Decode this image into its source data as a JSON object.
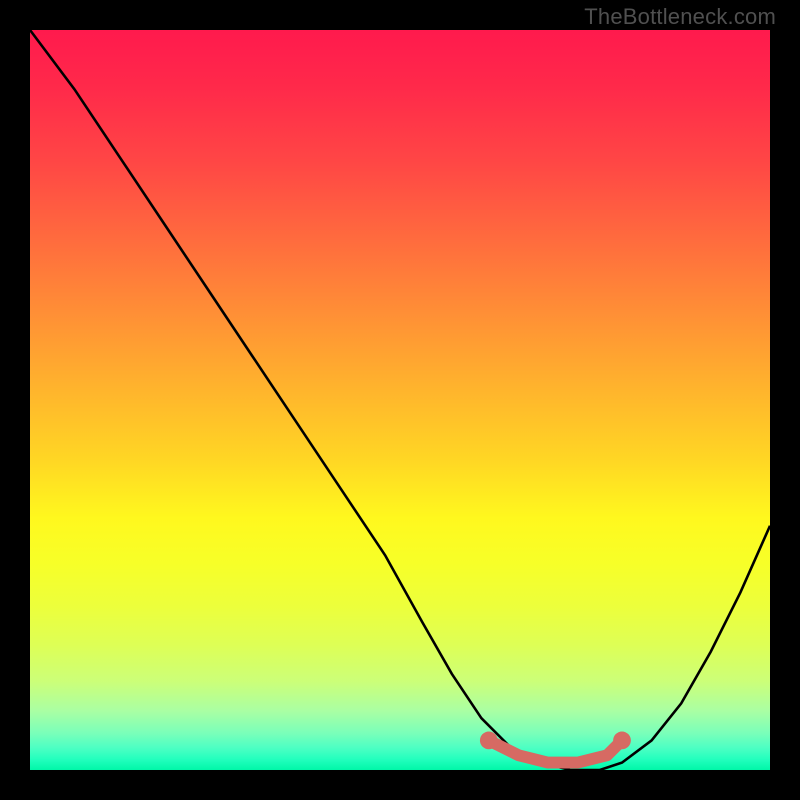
{
  "watermark": {
    "text": "TheBottleneck.com"
  },
  "colors": {
    "curve_stroke": "#000000",
    "highlight_stroke": "#d66a63",
    "highlight_fill": "#d66a63"
  },
  "chart_data": {
    "type": "line",
    "title": "",
    "xlabel": "",
    "ylabel": "",
    "xlim": [
      0,
      100
    ],
    "ylim": [
      0,
      100
    ],
    "series": [
      {
        "name": "bottleneck-curve",
        "x": [
          0,
          6,
          12,
          18,
          24,
          30,
          36,
          42,
          48,
          53,
          57,
          61,
          65,
          69,
          73,
          77,
          80,
          84,
          88,
          92,
          96,
          100
        ],
        "y": [
          100,
          92,
          83,
          74,
          65,
          56,
          47,
          38,
          29,
          20,
          13,
          7,
          3,
          1,
          0,
          0,
          1,
          4,
          9,
          16,
          24,
          33
        ]
      }
    ],
    "highlight": {
      "name": "optimal-range",
      "x": [
        62,
        66,
        70,
        74,
        78,
        80
      ],
      "y": [
        4,
        2,
        1,
        1,
        2,
        4
      ]
    }
  }
}
